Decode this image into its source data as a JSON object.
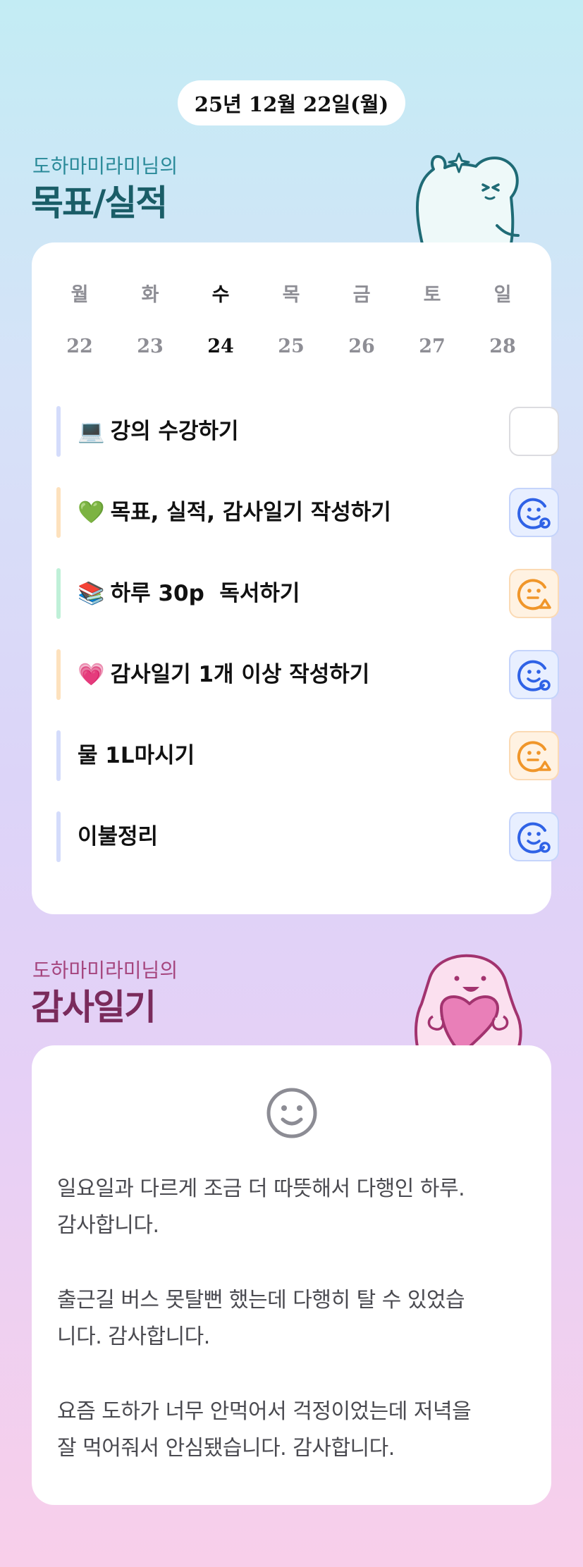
{
  "header": {
    "date": "25년 12월 22일(월)"
  },
  "goals_section": {
    "owner_label": "도하마미라미님의",
    "title": "목표/실적",
    "week": {
      "days": [
        "월",
        "화",
        "수",
        "목",
        "금",
        "토",
        "일"
      ],
      "dates": [
        "22",
        "23",
        "24",
        "25",
        "26",
        "27",
        "28"
      ],
      "today_index": 2
    },
    "items": [
      {
        "emoji": "💻",
        "text": "강의 수강하기",
        "bar_color": "#d4dcfb",
        "status": "empty"
      },
      {
        "emoji": "💚",
        "text": "목표, 실적, 감사일기 작성하기",
        "bar_color": "#fde1bd",
        "status": "done"
      },
      {
        "emoji": "📚",
        "text": "하루 30p  독서하기",
        "bar_color": "#bff0d8",
        "status": "partial"
      },
      {
        "emoji": "💗",
        "text": "감사일기 1개 이상 작성하기",
        "bar_color": "#fde1bd",
        "status": "done"
      },
      {
        "emoji": "",
        "text": "물 1L마시기",
        "bar_color": "#d4dcfb",
        "status": "partial"
      },
      {
        "emoji": "",
        "text": "이불정리",
        "bar_color": "#d4dcfb",
        "status": "done"
      }
    ]
  },
  "gratitude_section": {
    "owner_label": "도하마미라미님의",
    "title": "감사일기",
    "mood_icon": "smile-face-icon",
    "paragraphs": [
      [
        "일요일과 다르게 조금 더 따뜻해서 다행인 하루.",
        "감사합니다."
      ],
      [
        "출근길 버스 못탈뻔 했는데 다행히 탈 수 있었습",
        "니다. 감사합니다."
      ],
      [
        "요즘 도하가 너무 안먹어서 걱정이었는데 저녁을",
        "잘 먹어줘서 안심됐습니다. 감사합니다."
      ]
    ]
  },
  "colors": {
    "check_done": "#2f62e6",
    "check_partial": "#f0962a"
  }
}
